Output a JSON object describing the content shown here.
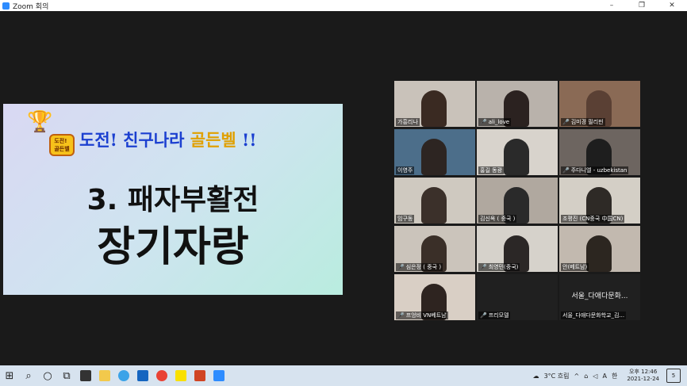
{
  "window": {
    "title": "Zoom 회의",
    "controls": [
      "–",
      "❐",
      "✕"
    ]
  },
  "slide": {
    "headline_a": "도전! 친구나라 ",
    "headline_b": "골든벨",
    "headline_c": " !!",
    "logo_text": "도전!\n골든벨",
    "title_line1": "3. 패자부활전",
    "title_line2": "장기자랑"
  },
  "participants": [
    {
      "name": "가흥리나",
      "muted": false
    },
    {
      "name": "ali_love",
      "muted": true
    },
    {
      "name": "김미경 필리핀",
      "muted": true
    },
    {
      "name": "이영주",
      "muted": false
    },
    {
      "name": "홍길 동광",
      "muted": false,
      "active": true
    },
    {
      "name": "주다니엘 - uzbekistan",
      "muted": true
    },
    {
      "name": "임구동",
      "muted": false
    },
    {
      "name": "김신옥 ( 중국 )",
      "muted": false
    },
    {
      "name": "조평진 (CN중국 中国CN)",
      "muted": false
    },
    {
      "name": "심은정 ( 중국 )",
      "muted": true
    },
    {
      "name": "최영민(중국)",
      "muted": true
    },
    {
      "name": "안(베트남)",
      "muted": false
    },
    {
      "name": "프엉비 VN베트남",
      "muted": true
    },
    {
      "name": "프리모델",
      "muted": true
    },
    {
      "name": "서울_다애다문화학교_김...",
      "muted": false,
      "video_off": true,
      "display_name": "서울_다애다문화..."
    }
  ],
  "taskbar": {
    "weather": "3°C 흐림",
    "ime": "A",
    "ime2": "한",
    "time": "오후 12:46",
    "date": "2021-12-24",
    "notifications": "5"
  }
}
